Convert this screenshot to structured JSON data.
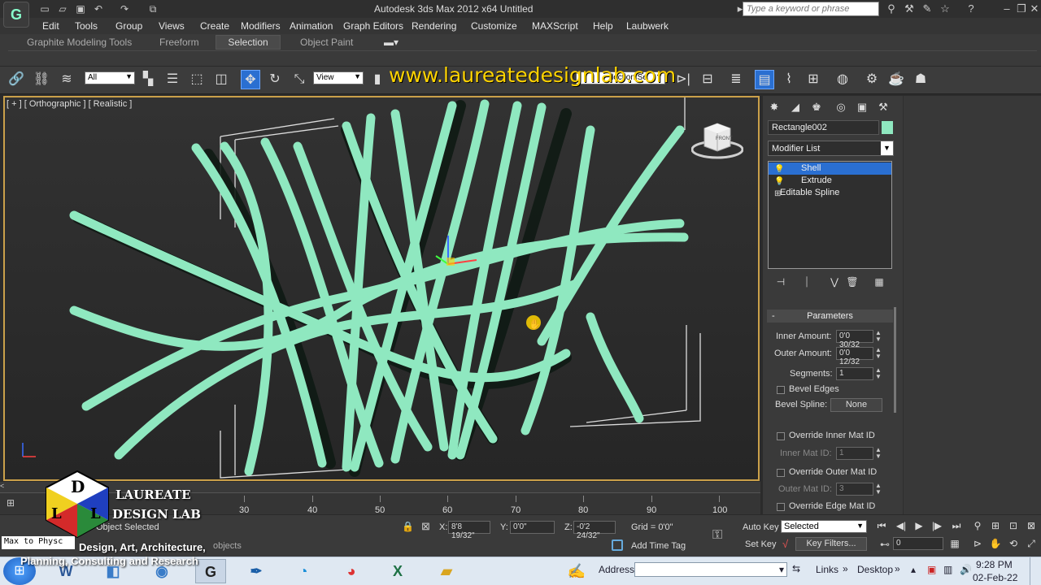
{
  "app": {
    "title": "Autodesk 3ds Max  2012 x64      Untitled",
    "logo": "G",
    "search_placeholder": "Type a keyword or phrase"
  },
  "menu": [
    "Edit",
    "Tools",
    "Group",
    "Views",
    "Create",
    "Modifiers",
    "Animation",
    "Graph Editors",
    "Rendering",
    "Customize",
    "MAXScript",
    "Help",
    "Laubwerk"
  ],
  "ribbon_tabs": [
    "Graphite Modeling Tools",
    "Freeform",
    "Selection",
    "Object Paint"
  ],
  "ribbon_active": "Selection",
  "toolbar": {
    "filter_value": "All",
    "refcoord_value": "View",
    "named_sel_value": "lection Se"
  },
  "watermark": "www.laureatedesignlab.com",
  "viewport": {
    "label": "[ + ] [ Orthographic ] [ Realistic ]",
    "viewcube_label": "FRONT",
    "accent_color": "#8fe8c0"
  },
  "panel": {
    "object_name": "Rectangle002",
    "object_color": "#8fe8c0",
    "modifier_list": "Modifier List",
    "stack": [
      {
        "label": "Shell",
        "selected": true
      },
      {
        "label": "Extrude",
        "selected": false
      },
      {
        "label": "Editable Spline",
        "selected": false
      }
    ],
    "rollout_title": "Parameters",
    "inner_amount_label": "Inner Amount:",
    "inner_amount_value": "0'0 30/32",
    "outer_amount_label": "Outer Amount:",
    "outer_amount_value": "0'0 12/32",
    "segments_label": "Segments:",
    "segments_value": "1",
    "bevel_edges_label": "Bevel Edges",
    "bevel_spline_label": "Bevel Spline:",
    "bevel_spline_value": "None",
    "override_inner_label": "Override Inner Mat ID",
    "inner_mat_label": "Inner Mat ID:",
    "inner_mat_value": "1",
    "override_outer_label": "Override Outer Mat ID",
    "outer_mat_label": "Outer Mat ID:",
    "outer_mat_value": "3",
    "override_edge_label": "Override Edge Mat ID"
  },
  "timeline": {
    "ticks": [
      "30",
      "40",
      "50",
      "60",
      "70",
      "80",
      "90",
      "100"
    ]
  },
  "status": {
    "selection_text": "Object Selected",
    "prompt_text": "objects",
    "maxscript": "Max to Physc",
    "x_label": "X:",
    "x_value": "8'8 19/32\"",
    "y_label": "Y:",
    "y_value": "0'0\"",
    "z_label": "Z:",
    "z_value": "-0'2 24/32\"",
    "grid": "Grid = 0'0\"",
    "add_time_tag": "Add Time Tag",
    "auto_key": "Auto Key",
    "set_key": "Set Key",
    "selected_dd": "Selected",
    "key_filters": "Key Filters...",
    "frame": "0"
  },
  "branding": {
    "logo_letters": "DLL",
    "name_line1": "LAUREATE",
    "name_line2": "DESIGN LAB",
    "tagline1": "Design, Art, Architecture,",
    "tagline2": "Planning, Consulting and Research"
  },
  "taskbar": {
    "address_label": "Address",
    "links_label": "Links",
    "desktop_label": "Desktop",
    "time": "9:28 PM",
    "date": "02-Feb-22",
    "apps": [
      "Word",
      "Explorer",
      "Chrome-like",
      "3ds Max",
      "Feather",
      "Edge",
      "Chrome",
      "Excel",
      "Folder"
    ]
  }
}
